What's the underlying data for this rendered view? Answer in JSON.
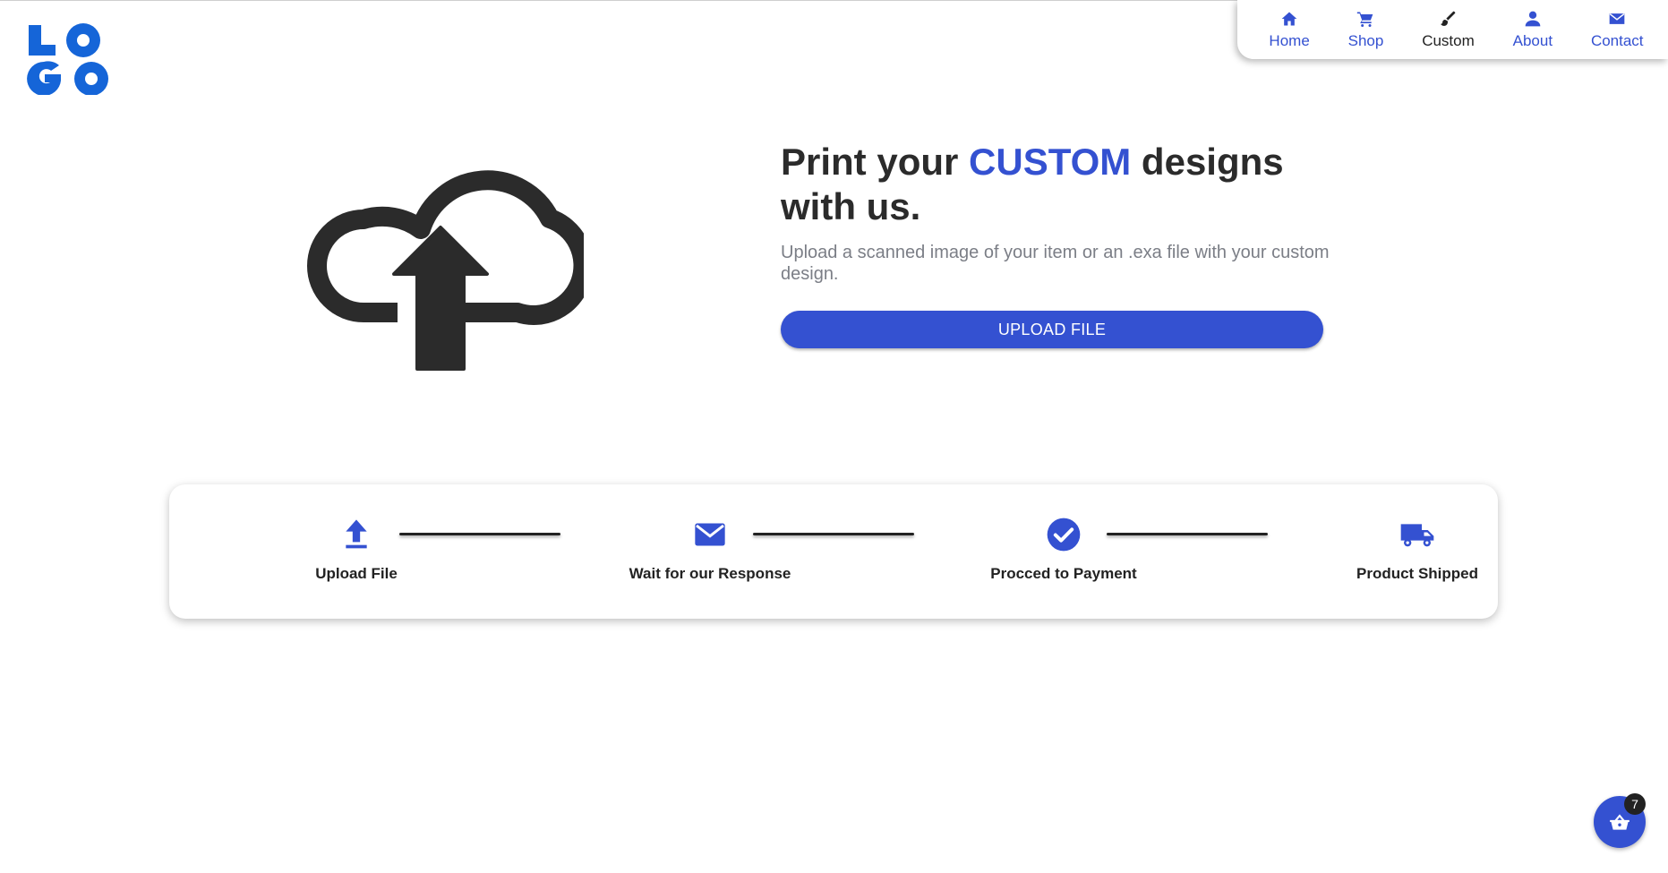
{
  "logo": {
    "text": "LOGO",
    "color": "#1565d8"
  },
  "nav": {
    "items": [
      {
        "label": "Home",
        "icon": "home-icon"
      },
      {
        "label": "Shop",
        "icon": "cart-icon"
      },
      {
        "label": "Custom",
        "icon": "brush-icon",
        "active": true
      },
      {
        "label": "About",
        "icon": "user-icon"
      },
      {
        "label": "Contact",
        "icon": "envelope-icon"
      }
    ]
  },
  "hero": {
    "title_before": "Print your ",
    "title_accent": "CUSTOM",
    "title_after": " designs with us.",
    "subtitle": "Upload a scanned image of your item or an .exa file with your custom design.",
    "button_label": "UPLOAD FILE",
    "illustration": "cloud-upload-icon"
  },
  "steps": [
    {
      "label": "Upload File",
      "icon": "upload-icon"
    },
    {
      "label": "Wait for our Response",
      "icon": "envelope-icon"
    },
    {
      "label": "Procced to Payment",
      "icon": "check-circle-icon"
    },
    {
      "label": "Product Shipped",
      "icon": "truck-icon"
    }
  ],
  "cart": {
    "count": "7",
    "icon": "basket-icon"
  },
  "colors": {
    "accent": "#3451d1",
    "text": "#2b2b2b",
    "muted": "#7b7e86",
    "logo": "#1565d8"
  }
}
